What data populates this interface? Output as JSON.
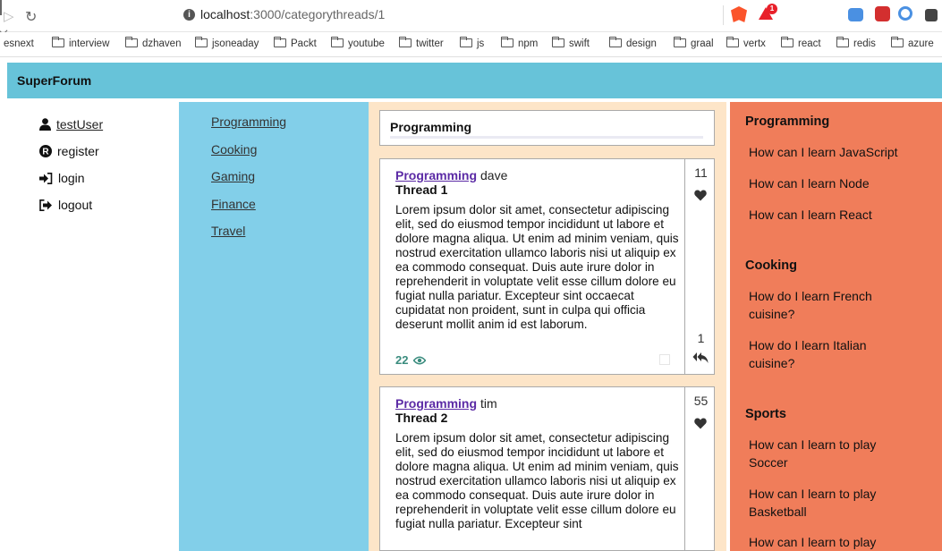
{
  "browser": {
    "url_host": "localhost",
    "url_rest": ":3000/categorythreads/1",
    "badge_count": "1",
    "bookmarks": [
      "esnext",
      "interview",
      "dzhaven",
      "jsoneaday",
      "Packt",
      "youtube",
      "twitter",
      "js",
      "npm",
      "swift",
      "design",
      "graal",
      "vertx",
      "react",
      "redis",
      "azure"
    ]
  },
  "app": {
    "title": "SuperForum"
  },
  "left_nav": {
    "user": "testUser",
    "register": "register",
    "login": "login",
    "logout": "logout"
  },
  "categories": [
    "Programming",
    "Cooking",
    "Gaming",
    "Finance",
    "Travel"
  ],
  "main": {
    "category_title": "Programming",
    "threads": [
      {
        "category": "Programming",
        "user": "dave",
        "title": "Thread 1",
        "body": "Lorem ipsum dolor sit amet, consectetur adipiscing elit, sed do eiusmod tempor incididunt ut labore et dolore magna aliqua. Ut enim ad minim veniam, quis nostrud exercitation ullamco laboris nisi ut aliquip ex ea commodo consequat. Duis aute irure dolor in reprehenderit in voluptate velit esse cillum dolore eu fugiat nulla pariatur. Excepteur sint occaecat cupidatat non proident, sunt in culpa qui officia deserunt mollit anim id est laborum.",
        "views": "22",
        "points": "11",
        "responses": "1"
      },
      {
        "category": "Programming",
        "user": "tim",
        "title": "Thread 2",
        "body": "Lorem ipsum dolor sit amet, consectetur adipiscing elit, sed do eiusmod tempor incididunt ut labore et dolore magna aliqua. Ut enim ad minim veniam, quis nostrud exercitation ullamco laboris nisi ut aliquip ex ea commodo consequat. Duis aute irure dolor in reprehenderit in voluptate velit esse cillum dolore eu fugiat nulla pariatur. Excepteur sint",
        "points": "55"
      }
    ]
  },
  "right_bar": {
    "groups": [
      {
        "heading": "Programming",
        "links": [
          "How can I learn JavaScript",
          "How can I learn Node",
          "How can I learn React"
        ]
      },
      {
        "heading": "Cooking",
        "links": [
          "How do I learn French cuisine?",
          "How do I learn Italian cuisine?"
        ]
      },
      {
        "heading": "Sports",
        "links": [
          "How can I learn to play Soccer",
          "How can I learn to play Basketball",
          "How can I learn to play"
        ]
      }
    ]
  },
  "colors": {
    "header": "#67c3d9",
    "category_nav": "#82cfe9",
    "main_bg": "#fde5c8",
    "right_bar": "#f07d5a",
    "category_link": "#5b2aa5",
    "views": "#3a8c7e"
  }
}
